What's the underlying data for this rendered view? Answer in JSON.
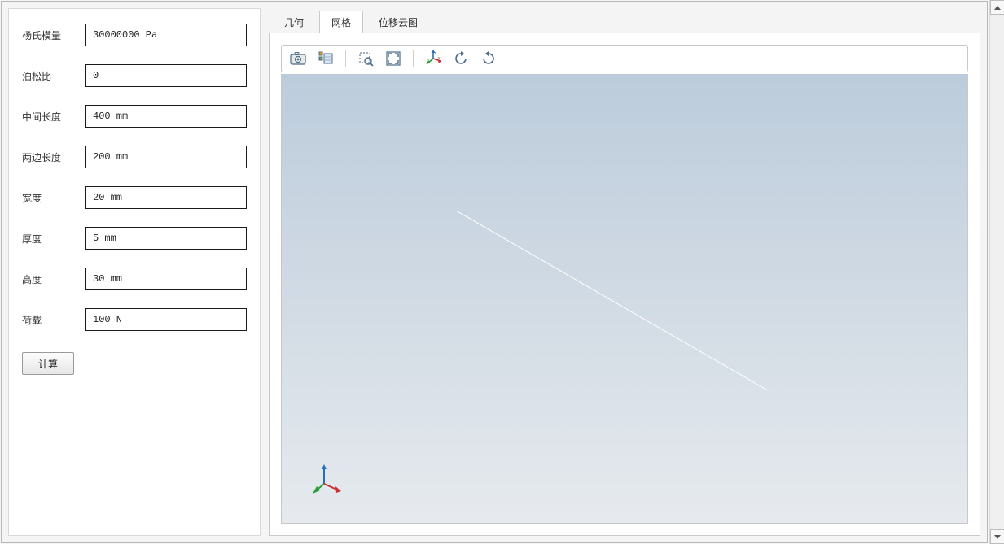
{
  "form": {
    "fields": [
      {
        "label": "杨氏模量",
        "value": "30000000 Pa"
      },
      {
        "label": "泊松比",
        "value": "0"
      },
      {
        "label": "中间长度",
        "value": "400 mm"
      },
      {
        "label": "两边长度",
        "value": "200 mm"
      },
      {
        "label": "宽度",
        "value": "20 mm"
      },
      {
        "label": "厚度",
        "value": "5 mm"
      },
      {
        "label": "高度",
        "value": "30 mm"
      },
      {
        "label": "荷载",
        "value": "100 N"
      }
    ],
    "compute_label": "计算"
  },
  "tabs": {
    "items": [
      {
        "label": "几何"
      },
      {
        "label": "网格"
      },
      {
        "label": "位移云图"
      }
    ],
    "active_index": 1
  },
  "toolbar_icons": [
    "screenshot-icon",
    "scene-icon",
    "zoom-box-icon",
    "zoom-extents-icon",
    "reset-view-icon",
    "rotate-ccw-icon",
    "rotate-cw-icon"
  ]
}
